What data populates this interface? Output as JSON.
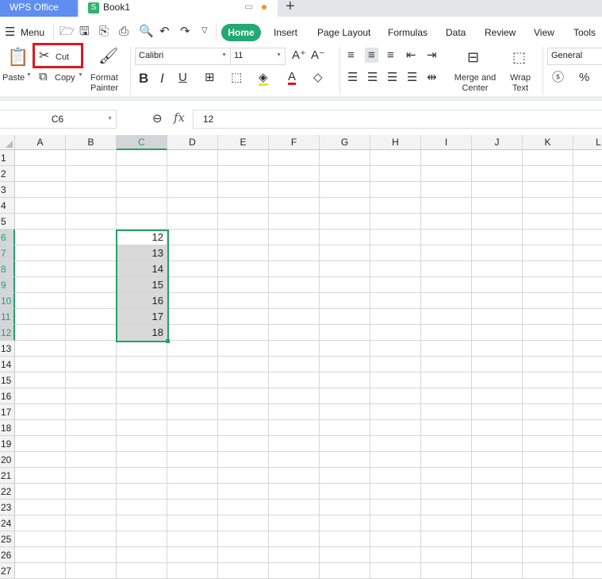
{
  "tabs": {
    "app": "WPS Office",
    "document": "Book1",
    "doc_icon": "S"
  },
  "menu": {
    "menu_label": "Menu",
    "items": [
      "Home",
      "Insert",
      "Page Layout",
      "Formulas",
      "Data",
      "Review",
      "View",
      "Tools"
    ],
    "active": "Home"
  },
  "ribbon": {
    "paste": "Paste",
    "cut": "Cut",
    "copy": "Copy",
    "format_painter_1": "Format",
    "format_painter_2": "Painter",
    "font": "Calibri",
    "font_size": "11",
    "merge_1": "Merge and",
    "merge_2": "Center",
    "wrap_1": "Wrap",
    "wrap_2": "Text",
    "number_format": "General",
    "percent": "%"
  },
  "formula_bar": {
    "name_box": "C6",
    "fx": "fx",
    "value": "12"
  },
  "grid": {
    "columns": [
      "A",
      "B",
      "C",
      "D",
      "E",
      "F",
      "G",
      "H",
      "I",
      "J",
      "K",
      "L"
    ],
    "rows": [
      "1",
      "2",
      "3",
      "4",
      "5",
      "6",
      "7",
      "8",
      "9",
      "10",
      "11",
      "12",
      "13",
      "14",
      "15",
      "16",
      "17",
      "18",
      "19",
      "20",
      "21",
      "22",
      "23",
      "24",
      "25",
      "26",
      "27"
    ],
    "c_values": {
      "6": "12",
      "7": "13",
      "8": "14",
      "9": "15",
      "10": "16",
      "11": "17",
      "12": "18"
    }
  },
  "colors": {
    "accent": "#21a366",
    "highlight": "#e3151d",
    "wps_tab": "#5f8ef0"
  }
}
